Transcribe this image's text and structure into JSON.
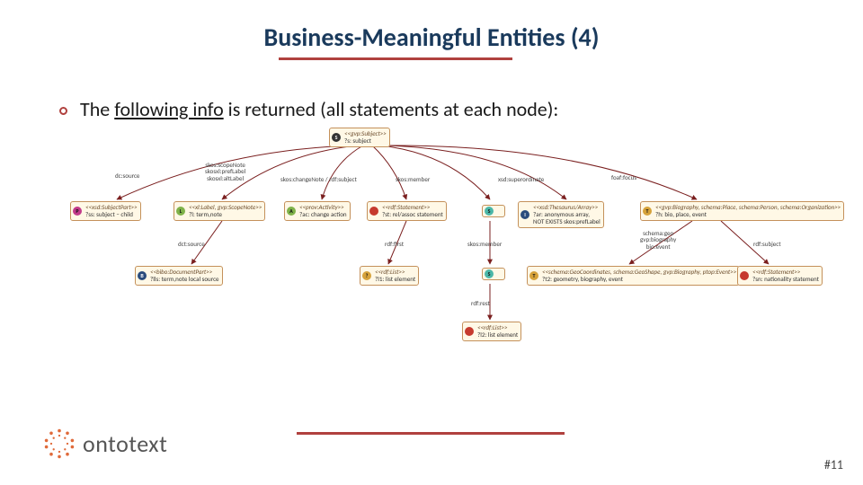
{
  "title": "Business-Meaningful Entities (4)",
  "bullet": {
    "pre": "The ",
    "underline": "following info",
    "post": " is returned (all statements at each node):"
  },
  "nodes": {
    "root": {
      "circ": "S",
      "circClass": "c-black",
      "stereo": "<<gvp:Subject>>",
      "label": "?s: subject"
    },
    "r1": {
      "circ": "P",
      "circClass": "c-mag",
      "stereo": "<<xsd:SubjectPart>>",
      "label": "?ss: subject – child"
    },
    "r2": {
      "circ": "L",
      "circClass": "c-lime",
      "stereo": "<<xl:Label, gvp:ScopeNote>>",
      "label": "?l: term,note"
    },
    "r3": {
      "circ": "A",
      "circClass": "c-lime",
      "stereo": "<<prov:Activity>>",
      "label": "?ac: change action"
    },
    "r4": {
      "circ": " ",
      "circClass": "c-red",
      "stereo": "<<rdf:Statement>>",
      "label": "?st: rel/assoc statement"
    },
    "r5": {
      "circ": "S",
      "circClass": "c-teal",
      "stereo": "",
      "label": ""
    },
    "r6": {
      "circ": "I",
      "circClass": "c-navy",
      "stereo": "<<xsd:Thesaurus/Array>>",
      "label": "?ar: anonymous array,\nNOT EXISTS skos:prefLabel"
    },
    "r7": {
      "circ": "T",
      "circClass": "c-amber",
      "stereo": "<<gvp:Biography, schema:Place, schema:Person, schema:Organization>>",
      "label": "?h: bio, place, event"
    },
    "r31": {
      "circ": "B",
      "circClass": "c-navy",
      "stereo": "<<bibo:DocumentPart>>",
      "label": "?lls: term,note local source"
    },
    "r41": {
      "circ": "?",
      "circClass": "c-amber",
      "stereo": "<<rdf:List>>",
      "label": "?l1: list element"
    },
    "r51": {
      "circ": "S",
      "circClass": "c-teal",
      "stereo": "",
      "label": ""
    },
    "r71": {
      "circ": "T",
      "circClass": "c-amber",
      "stereo": "<<schema:GeoCoordinates, schema:GeoShape, gvp:Biography, ptop:Event>>",
      "label": "?t2: geometry, biography, event"
    },
    "r72": {
      "circ": " ",
      "circClass": "c-red",
      "stereo": "<<rdf:Statement>>",
      "label": "?sn: nationality statement"
    },
    "r411": {
      "circ": " ",
      "circClass": "c-red",
      "stereo": "<<rdf:List>>",
      "label": "?l2: list element"
    }
  },
  "edges": {
    "e_root_r1": "dc:source",
    "e_root_r2": "skos:scopeNote\nskosxl:prefLabel\nskosxl:altLabel",
    "e_root_r3": "skos:changeNote / rdf:subject",
    "e_root_r4": "skos:member",
    "e_root_r6": "xsd:superordinate",
    "e_root_r7": "foaf:focus",
    "e_r3_r31": "dct:source",
    "e_r4_r41": "rdf:first",
    "e_r5_r51": "skos:member",
    "e_r7_r71": "schema:geo\ngvp:biography\nbio:event",
    "e_r7_r72": "rdf:subject",
    "e_r41_r411": "rdf:rest"
  },
  "logo": "ontotext",
  "page": "#11"
}
